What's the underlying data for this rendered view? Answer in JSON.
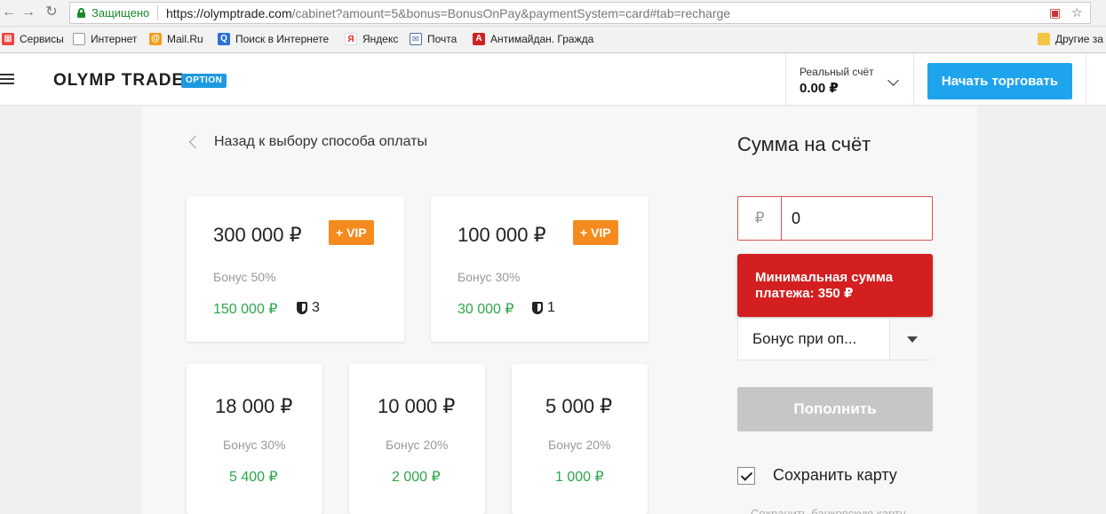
{
  "browser": {
    "secure_label": "Защищено",
    "url_host": "https://olymptrade.com",
    "url_path": "/cabinet?amount=5&bonus=BonusOnPay&paymentSystem=card#tab=recharge",
    "bookmarks": [
      "Сервисы",
      "Интернет",
      "Mail.Ru",
      "Поиск в Интернете",
      "Яндекс",
      "Почта",
      "Антимайдан. Гражда"
    ],
    "other_bookmarks": "Другие за"
  },
  "header": {
    "logo": "OLYMP TRADE",
    "badge": "OPTION",
    "account_label": "Реальный счёт",
    "account_value": "0.00 ₽",
    "start_button": "Начать торговать"
  },
  "main": {
    "back_link": "Назад к выбору способа оплаты",
    "vip_label": "+ VIP",
    "cards": [
      {
        "amount": "300 000 ₽",
        "bonus": "Бонус 50%",
        "bonus_amount": "150 000 ₽",
        "vip": true,
        "shield_count": "3"
      },
      {
        "amount": "100 000 ₽",
        "bonus": "Бонус 30%",
        "bonus_amount": "30 000 ₽",
        "vip": true,
        "shield_count": "1"
      },
      {
        "amount": "18 000 ₽",
        "bonus": "Бонус 30%",
        "bonus_amount": "5 400 ₽"
      },
      {
        "amount": "10 000 ₽",
        "bonus": "Бонус 20%",
        "bonus_amount": "2 000 ₽"
      },
      {
        "amount": "5 000 ₽",
        "bonus": "Бонус 20%",
        "bonus_amount": "1 000 ₽"
      }
    ]
  },
  "panel": {
    "title": "Сумма на счёт",
    "currency_symbol": "₽",
    "amount_value": "0",
    "error_line1": "Минимальная сумма",
    "error_line2": "платежа: 350 ₽",
    "bonus_select": "Бонус при оп...",
    "topup_button": "Пополнить",
    "save_card_label": "Сохранить карту",
    "footnote": "Сохранить банковскую карту"
  },
  "colors": {
    "accent": "#1ea4ec",
    "vip": "#f58a1f",
    "bonus_green": "#2ba84a",
    "error": "#d31f1f"
  }
}
